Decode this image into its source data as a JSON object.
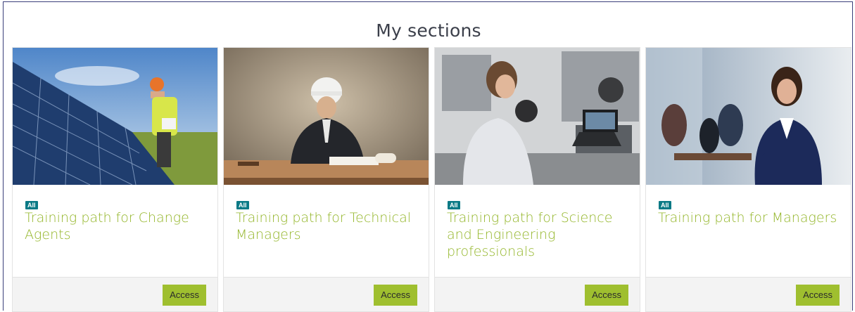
{
  "page": {
    "title": "My sections"
  },
  "cards": [
    {
      "badge": "All",
      "title": "Training path for Change Agents",
      "button": "Access",
      "image": "solar-panel-engineer-photo"
    },
    {
      "badge": "All",
      "title": "Training path for Technical Managers",
      "button": "Access",
      "image": "engineer-at-desk-photo"
    },
    {
      "badge": "All",
      "title": "Training path for Science and Engineering professionals",
      "button": "Access",
      "image": "woman-laptop-lab-photo"
    },
    {
      "badge": "All",
      "title": "Training path for Managers",
      "button": "Access",
      "image": "businesswoman-office-photo"
    }
  ],
  "colors": {
    "accent": "#9fbf2f",
    "title_green": "#94b62a",
    "badge": "#0b7a86",
    "border": "#3a3f7a"
  }
}
